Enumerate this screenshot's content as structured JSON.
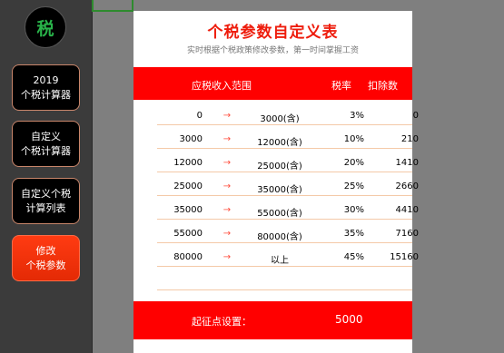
{
  "logo": {
    "text": "税"
  },
  "sidebar": {
    "items": [
      {
        "line1": "2019",
        "line2": "个税计算器"
      },
      {
        "line1": "自定义",
        "line2": "个税计算器"
      },
      {
        "line1": "自定义个税",
        "line2": "计算列表"
      },
      {
        "line1": "修改",
        "line2": "个税参数"
      }
    ]
  },
  "page": {
    "title": "个税参数自定义表",
    "subtitle": "实时根据个税政策修改参数，第一时间掌握工资"
  },
  "table": {
    "headers": {
      "range": "应税收入范围",
      "rate": "税率",
      "deduction": "扣除数"
    },
    "arrow": "→",
    "rows": [
      {
        "low": "0",
        "high": "3000(含)",
        "rate": "3%",
        "deduction": "0"
      },
      {
        "low": "3000",
        "high": "12000(含)",
        "rate": "10%",
        "deduction": "210"
      },
      {
        "low": "12000",
        "high": "25000(含)",
        "rate": "20%",
        "deduction": "1410"
      },
      {
        "low": "25000",
        "high": "35000(含)",
        "rate": "25%",
        "deduction": "2660"
      },
      {
        "low": "35000",
        "high": "55000(含)",
        "rate": "30%",
        "deduction": "4410"
      },
      {
        "low": "55000",
        "high": "80000(含)",
        "rate": "35%",
        "deduction": "7160"
      },
      {
        "low": "80000",
        "high": "以上",
        "rate": "45%",
        "deduction": "15160"
      }
    ]
  },
  "footer": {
    "label": "起征点设置：",
    "value": "5000"
  },
  "colors": {
    "accent": "#ff0000",
    "sidebar": "#3b3b3b",
    "logo_text": "#29b34a"
  }
}
